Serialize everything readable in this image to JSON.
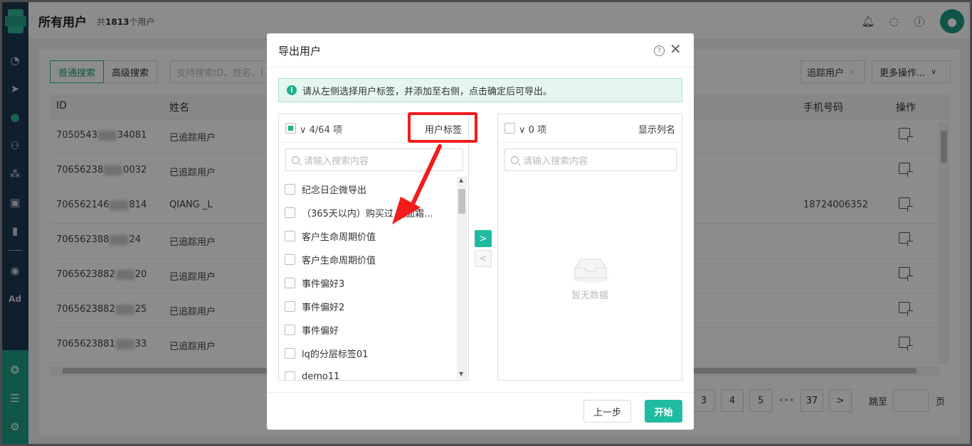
{
  "header": {
    "title": "所有用户",
    "count_prefix": "共",
    "count": "1813",
    "count_suffix": "个用户"
  },
  "sidebar": {
    "items": [
      "dashboard-icon",
      "send-icon",
      "user-icon",
      "users-icon",
      "group-icon",
      "badge-icon",
      "chart-icon",
      "wechat-icon",
      "ad-label"
    ],
    "ad_text": "Ad",
    "bottom_items": [
      "ai-icon",
      "server-icon",
      "gear-icon"
    ]
  },
  "toolbar": {
    "normal_search": "普通搜索",
    "advanced_search": "高级搜索",
    "search_placeholder": "支持搜索ID、姓名、I",
    "track_select": "追踪用户",
    "more_ops": "更多操作..."
  },
  "table": {
    "headers": {
      "id": "ID",
      "name": "姓名",
      "phone": "手机号码",
      "ops": "操作"
    },
    "rows": [
      {
        "id_a": "7050543",
        "id_b": "34081",
        "name": "已追踪用户",
        "phone": ""
      },
      {
        "id_a": "70656238",
        "id_b": "0032",
        "name": "已追踪用户",
        "phone": ""
      },
      {
        "id_a": "706562146",
        "id_b": "814",
        "name": "QIANG _L",
        "phone": "18724006352"
      },
      {
        "id_a": "706562388",
        "id_b": "24",
        "name": "已追踪用户",
        "phone": ""
      },
      {
        "id_a": "7065623882",
        "id_b": "20",
        "name": "已追踪用户",
        "phone": ""
      },
      {
        "id_a": "7065623882",
        "id_b": "25",
        "name": "已追踪用户",
        "phone": ""
      },
      {
        "id_a": "7065623881",
        "id_b": "33",
        "name": "已追踪用户",
        "phone": ""
      }
    ]
  },
  "pagination": {
    "pages": [
      "3",
      "4",
      "5"
    ],
    "dots": "•••",
    "last": "37",
    "next": ">",
    "jump_label": "跳至",
    "page_label": "页"
  },
  "modal": {
    "title": "导出用户",
    "help": "?",
    "close": "✕",
    "alert": "请从左侧选择用户标签，并添加至右侧，点击确定后可导出。",
    "alert_icon": "i",
    "left": {
      "count": "∨ 4/64 项",
      "tab": "用户标签",
      "search_placeholder": "请输入搜索内容",
      "items": [
        "纪念日企微导出",
        "（365天以内）购买过 太面霜...",
        "客户生命周期价值",
        "客户生命周期价值",
        "事件偏好3",
        "事件偏好2",
        "事件偏好",
        "lq的分层标签01",
        "demo11"
      ]
    },
    "right": {
      "count": "∨ 0 项",
      "tab": "显示列名",
      "search_placeholder": "请输入搜索内容",
      "empty": "暂无数据"
    },
    "to_right": ">",
    "to_left": "<",
    "prev_button": "上一步",
    "start_button": "开始"
  },
  "colors": {
    "accent": "#1fbba0",
    "sidebar": "#1f3a52",
    "annotation": "#f21c1c"
  }
}
